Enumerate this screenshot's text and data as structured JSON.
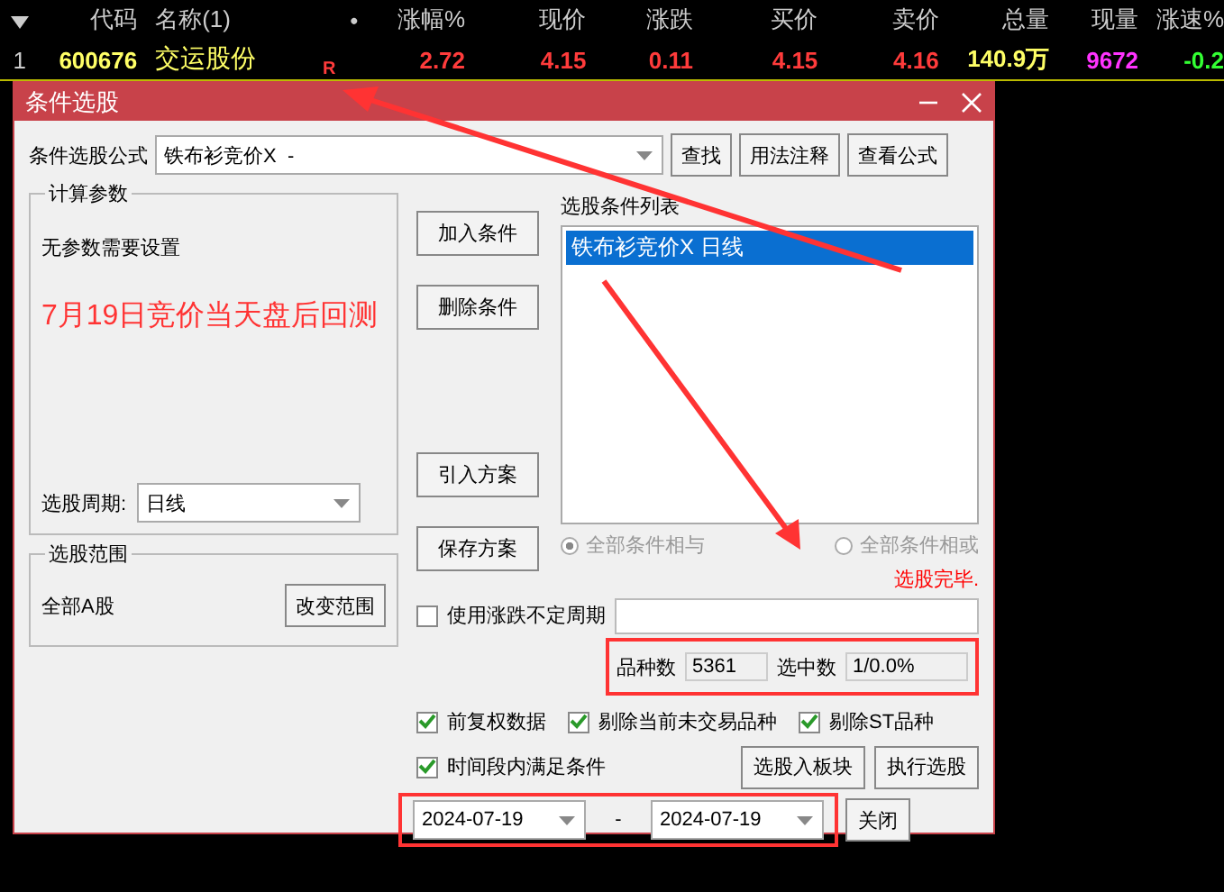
{
  "quote_table": {
    "columns": [
      "代码",
      "名称(1)",
      "•",
      "涨幅%",
      "现价",
      "涨跌",
      "买价",
      "卖价",
      "总量",
      "现量",
      "涨速%"
    ],
    "rows": [
      {
        "index": "1",
        "cells": [
          {
            "text": "600676",
            "color": "#ffff66"
          },
          {
            "text": "交运股份",
            "color": "#ffff66"
          },
          {
            "text": "R",
            "color": "#ff3b3b"
          },
          {
            "text": "2.72",
            "color": "#ff3b3b"
          },
          {
            "text": "4.15",
            "color": "#ff3b3b"
          },
          {
            "text": "0.11",
            "color": "#ff3b3b"
          },
          {
            "text": "4.15",
            "color": "#ff3b3b"
          },
          {
            "text": "4.16",
            "color": "#ff3b3b"
          },
          {
            "text": "140.9万",
            "color": "#ffff66"
          },
          {
            "text": "9672",
            "color": "#ff33ff"
          },
          {
            "text": "-0.2",
            "color": "#33ff33"
          }
        ]
      }
    ]
  },
  "dialog": {
    "title": "条件选股",
    "formula_label": "条件选股公式",
    "formula_value": "铁布衫竞价X  -",
    "top_buttons": [
      "查找",
      "用法注释",
      "查看公式"
    ],
    "params_title": "计算参数",
    "params_text": "无参数需要设置",
    "annotation": "7月19日竞价当天盘后回测",
    "period_label": "选股周期:",
    "period_value": "日线",
    "range_title": "选股范围",
    "range_text": "全部A股",
    "range_button": "改变范围",
    "side_buttons": [
      "加入条件",
      "删除条件",
      "引入方案",
      "保存方案"
    ],
    "list_title": "选股条件列表",
    "conditions": [
      {
        "text": "铁布衫竞价X  日线",
        "selected": true
      }
    ],
    "logic": [
      {
        "label": "全部条件相与",
        "selected": true
      },
      {
        "label": "全部条件相或",
        "selected": false
      }
    ],
    "status": "选股完毕.",
    "variable_period": {
      "label": "使用涨跌不定周期",
      "checked": false
    },
    "count_label": "品种数",
    "count_value": "5361",
    "hit_label": "选中数",
    "hit_value": "1/0.0%",
    "options": [
      {
        "label": "前复权数据",
        "checked": true
      },
      {
        "label": "剔除当前未交易品种",
        "checked": true
      },
      {
        "label": "剔除ST品种",
        "checked": true
      }
    ],
    "range_option": {
      "label": "时间段内满足条件",
      "checked": true
    },
    "action_buttons": [
      "选股入板块",
      "执行选股"
    ],
    "date_from": "2024-07-19",
    "date_sep": "-",
    "date_to": "2024-07-19",
    "close_button": "关闭"
  }
}
